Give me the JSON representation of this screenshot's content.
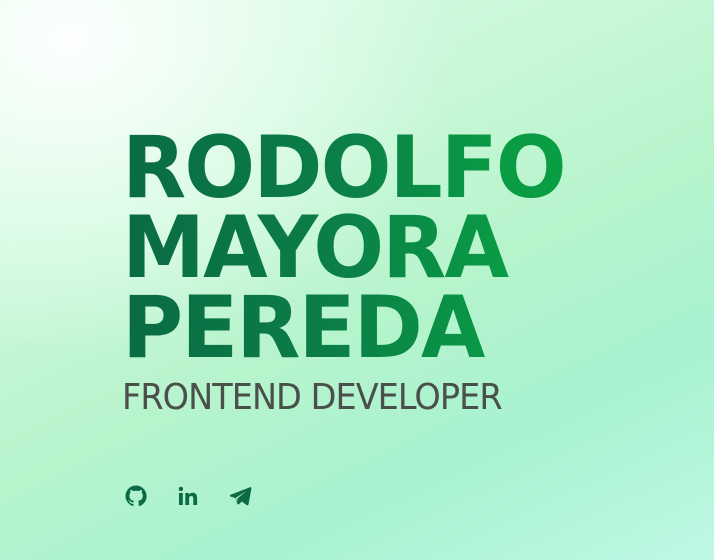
{
  "hero": {
    "name_lines": [
      "RODOLFO",
      "MAYORA",
      "PEREDA"
    ],
    "role": "FRONTEND DEVELOPER"
  },
  "socials": [
    {
      "icon": "github-icon"
    },
    {
      "icon": "linkedin-icon"
    },
    {
      "icon": "telegram-icon"
    }
  ],
  "colors": {
    "name_gradient_start": "#0a6b43",
    "name_gradient_end": "#08a443",
    "role_text": "#4a4f4c",
    "icon": "#0c6a44"
  }
}
